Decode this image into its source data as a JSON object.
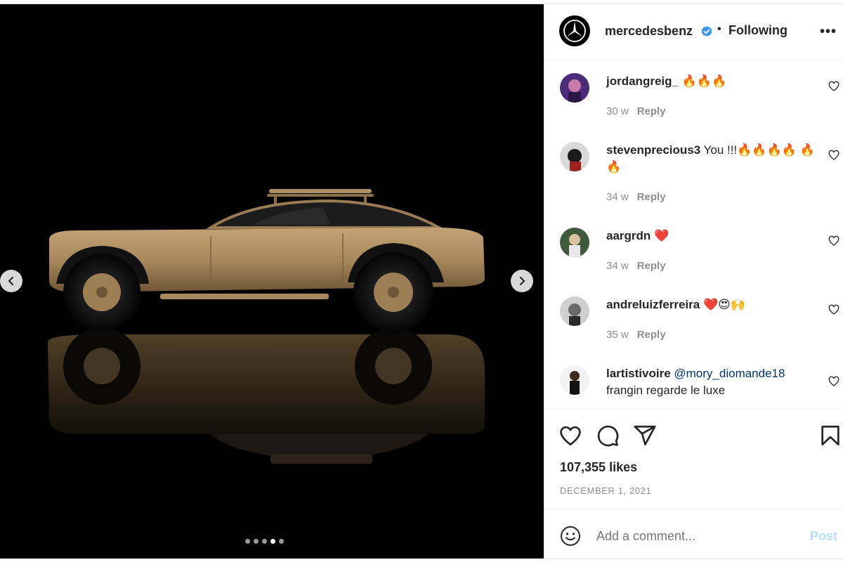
{
  "colors": {
    "accent": "#0095f6",
    "post_disabled": "#b2dffc",
    "verified": "#3897f0",
    "car_body": "#a7885c",
    "media_bg": "#000000"
  },
  "media": {
    "icons": {
      "prev": "chevron-left-icon",
      "next": "chevron-right-icon"
    },
    "carousel": {
      "count": 5,
      "active_index": 3
    }
  },
  "header": {
    "username": "mercedesbenz",
    "separator": "•",
    "follow_label": "Following",
    "more_label": "•••",
    "icons": {
      "avatar": "mercedes-star-logo",
      "verified": "verified-badge-icon"
    }
  },
  "comments": [
    {
      "username": "jordangreig_",
      "text": "🔥🔥🔥",
      "age": "30 w",
      "reply": "Reply"
    },
    {
      "username": "stevenprecious3",
      "text": "You !!!🔥🔥🔥🔥 🔥🔥",
      "age": "34 w",
      "reply": "Reply"
    },
    {
      "username": "aargrdn",
      "text": "❤️",
      "age": "34 w",
      "reply": "Reply"
    },
    {
      "username": "andreluizferreira",
      "text": "❤️😍🙌",
      "age": "35 w",
      "reply": "Reply"
    },
    {
      "username": "lartistivoire",
      "mention": "@mory_diomande18",
      "text": "frangin regarde le luxe"
    }
  ],
  "actions": {
    "icons": [
      "heart-icon",
      "comment-icon",
      "share-icon",
      "bookmark-icon"
    ],
    "likes": "107,355 likes",
    "date": "DECEMBER 1, 2021"
  },
  "composer": {
    "placeholder": "Add a comment...",
    "post_label": "Post",
    "emoji_icon": "emoji-icon"
  }
}
